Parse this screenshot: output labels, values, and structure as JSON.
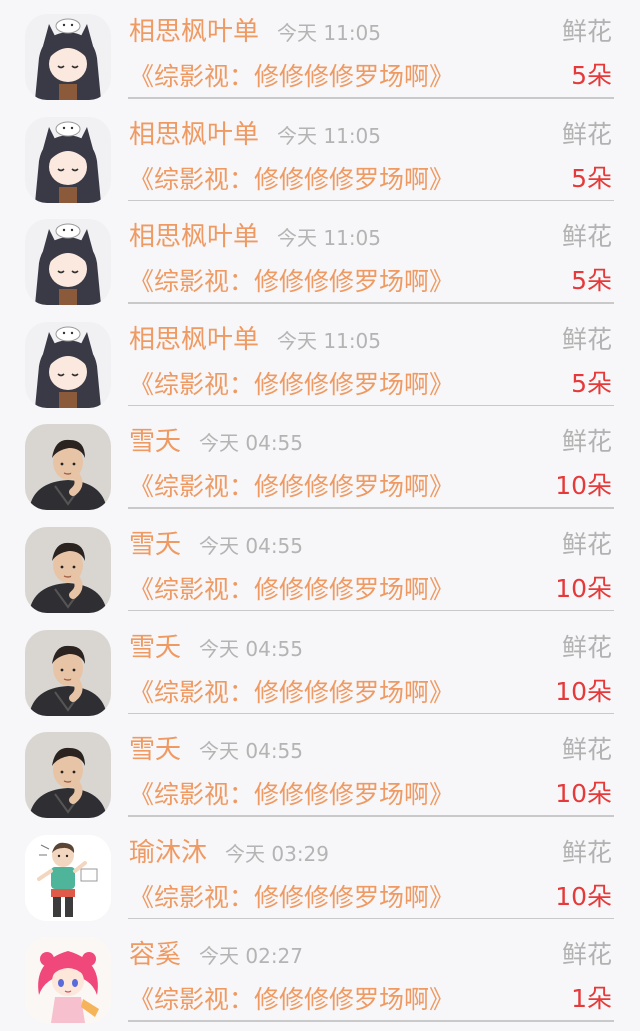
{
  "colors": {
    "background": "#f7f6f8",
    "name": "#ef9a62",
    "book": "#ef9a62",
    "time": "#b4b4b4",
    "label": "#b2b2b2",
    "count": "#e63a3a",
    "divider": "#c9c9c9"
  },
  "rows": [
    {
      "avatar": "anime-cat-girl-avatar",
      "name": "相思枫叶单",
      "time": "今天 11:05",
      "label": "鲜花",
      "book": "《综影视：修修修修罗场啊》",
      "count": "5朵"
    },
    {
      "avatar": "anime-cat-girl-avatar",
      "name": "相思枫叶单",
      "time": "今天 11:05",
      "label": "鲜花",
      "book": "《综影视：修修修修罗场啊》",
      "count": "5朵"
    },
    {
      "avatar": "anime-cat-girl-avatar",
      "name": "相思枫叶单",
      "time": "今天 11:05",
      "label": "鲜花",
      "book": "《综影视：修修修修罗场啊》",
      "count": "5朵"
    },
    {
      "avatar": "anime-cat-girl-avatar",
      "name": "相思枫叶单",
      "time": "今天 11:05",
      "label": "鲜花",
      "book": "《综影视：修修修修罗场啊》",
      "count": "5朵"
    },
    {
      "avatar": "man-portrait-avatar",
      "name": "雪夭",
      "time": "今天 04:55",
      "label": "鲜花",
      "book": "《综影视：修修修修罗场啊》",
      "count": "10朵"
    },
    {
      "avatar": "man-portrait-avatar",
      "name": "雪夭",
      "time": "今天 04:55",
      "label": "鲜花",
      "book": "《综影视：修修修修罗场啊》",
      "count": "10朵"
    },
    {
      "avatar": "man-portrait-avatar",
      "name": "雪夭",
      "time": "今天 04:55",
      "label": "鲜花",
      "book": "《综影视：修修修修罗场啊》",
      "count": "10朵"
    },
    {
      "avatar": "man-portrait-avatar",
      "name": "雪夭",
      "time": "今天 04:55",
      "label": "鲜花",
      "book": "《综影视：修修修修罗场啊》",
      "count": "10朵"
    },
    {
      "avatar": "cartoon-boy-avatar",
      "name": "瑜沐沐",
      "time": "今天 03:29",
      "label": "鲜花",
      "book": "《综影视：修修修修罗场啊》",
      "count": "10朵"
    },
    {
      "avatar": "pink-hair-girl-avatar",
      "name": "容奚",
      "time": "今天 02:27",
      "label": "鲜花",
      "book": "《综影视：修修修修罗场啊》",
      "count": "1朵"
    }
  ]
}
